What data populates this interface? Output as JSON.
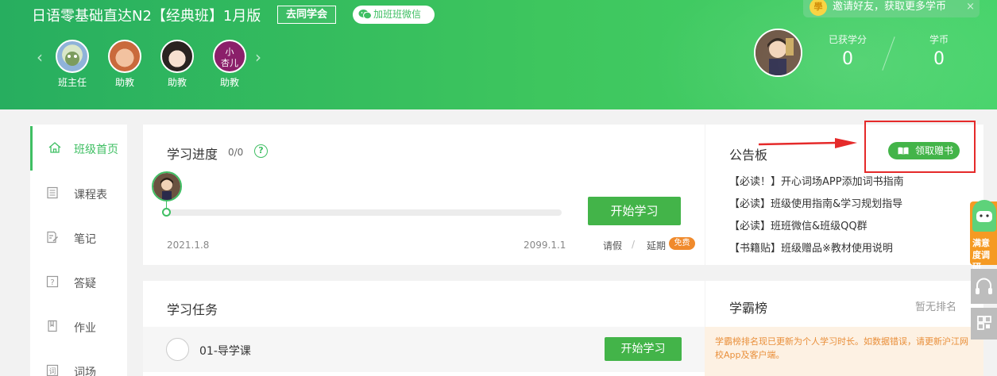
{
  "header": {
    "class_title": "日语零基础直达N2【经典班】1月版",
    "tongxue_button": "去同学会",
    "wechat_button": "加班班微信",
    "invite_text": "邀请好友，获取更多学币",
    "invite_close": "×",
    "teachers": [
      {
        "role": "班主任"
      },
      {
        "role": "助教"
      },
      {
        "role": "助教"
      },
      {
        "role": "助教"
      }
    ],
    "prev_arrow": "‹",
    "next_arrow": "›",
    "stats": {
      "credits_label": "已获学分",
      "credits_value": "0",
      "coins_label": "学币",
      "coins_value": "0"
    }
  },
  "sidebar": {
    "items": [
      {
        "label": "班级首页",
        "icon": "home-icon",
        "active": true
      },
      {
        "label": "课程表",
        "icon": "schedule-icon"
      },
      {
        "label": "笔记",
        "icon": "note-icon"
      },
      {
        "label": "答疑",
        "icon": "qa-icon"
      },
      {
        "label": "作业",
        "icon": "homework-icon"
      },
      {
        "label": "词场",
        "icon": "vocab-icon"
      }
    ]
  },
  "progress": {
    "title": "学习进度",
    "value": "0/0",
    "help": "?",
    "start_date": "2021.1.8",
    "end_date": "2099.1.1",
    "start_button": "开始学习",
    "leave": "请假",
    "separator": "/",
    "extend": "延期",
    "free_badge": "免费"
  },
  "notice": {
    "title": "公告板",
    "gift_button": "领取赠书",
    "items": [
      "【必读！】开心词场APP添加词书指南",
      "【必读】班级使用指南&学习规划指导",
      "【必读】班班微信&班级QQ群",
      "【书籍贴】班级赠品※教材使用说明"
    ]
  },
  "tasks": {
    "title": "学习任务",
    "items": [
      {
        "label": "01-导学课",
        "button": "开始学习"
      }
    ]
  },
  "ranking": {
    "title": "学霸榜",
    "empty": "暂无排名",
    "note": "学霸榜排名现已更新为个人学习时长。如数据错误，请更新沪江网校App及客户端。"
  },
  "float": {
    "survey": "满意度调研"
  },
  "colors": {
    "brand_green": "#43b449",
    "header_green": "#3ec65e",
    "badge_orange": "#f08a2c",
    "highlight_red": "#e52a2a"
  }
}
